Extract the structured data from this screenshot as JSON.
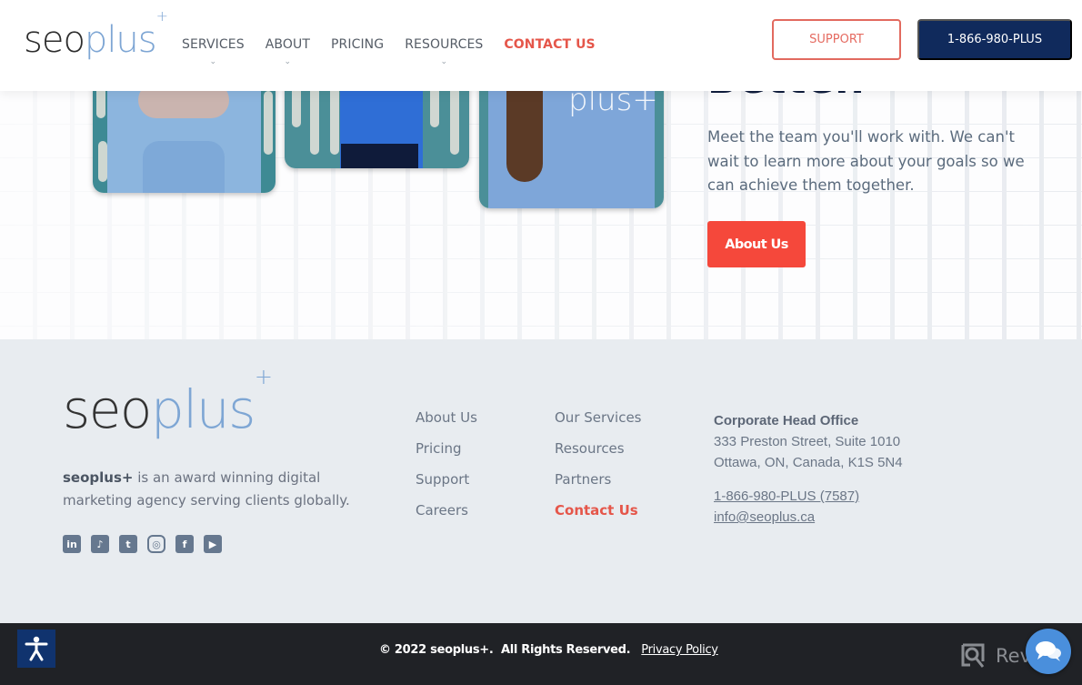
{
  "header": {
    "logo": {
      "seo": "seo",
      "plus": "plus",
      "sup": "+"
    },
    "nav": [
      {
        "label": "SERVICES",
        "has_dropdown": true
      },
      {
        "label": "ABOUT",
        "has_dropdown": true
      },
      {
        "label": "PRICING",
        "has_dropdown": false
      },
      {
        "label": "RESOURCES",
        "has_dropdown": true
      },
      {
        "label": "CONTACT US",
        "has_dropdown": false,
        "active": true
      }
    ],
    "chevron": "⌄",
    "support_label": "SUPPORT",
    "phone_label": "1-866-980-PLUS"
  },
  "hero": {
    "heading": "Better.",
    "text": "Meet the team you'll work with. We can't wait to learn more about your goals so we can achieve them together.",
    "button_label": "About Us",
    "photo_shirt_text": "plus+",
    "photo_shirt_text_2": "seoplus"
  },
  "footer": {
    "logo": {
      "seo": "seo",
      "plus": "plus",
      "sup": "+"
    },
    "desc_brand": "seoplus+",
    "desc_text": " is an award winning digital marketing agency serving clients globally.",
    "socials": [
      {
        "name": "linkedin-icon",
        "glyph": "in"
      },
      {
        "name": "tiktok-icon",
        "glyph": "♪"
      },
      {
        "name": "twitter-icon",
        "glyph": "t"
      },
      {
        "name": "instagram-icon",
        "glyph": "◎"
      },
      {
        "name": "facebook-icon",
        "glyph": "f"
      },
      {
        "name": "youtube-icon",
        "glyph": "▶"
      }
    ],
    "col1": [
      "About Us",
      "Pricing",
      "Support",
      "Careers"
    ],
    "col2": [
      "Our Services",
      "Resources",
      "Partners",
      "Contact Us"
    ],
    "office": {
      "title": "Corporate Head Office",
      "address1": "333 Preston Street, Suite 1010",
      "address2": "Ottawa, ON, Canada, K1S 5N4",
      "phone": "1-866-980-PLUS (7587)",
      "email": "info@seoplus.ca"
    }
  },
  "bottom": {
    "copyright": "© 2022 seoplus+.  All Rights Reserved.",
    "privacy": "Privacy Policy",
    "revain": "Revain"
  },
  "colors": {
    "accent": "#f5483b",
    "navy": "#102a5c",
    "footer_bg": "#e8ecf0",
    "bottom_bg": "#202226",
    "logo_blue": "#7ea6d4"
  }
}
